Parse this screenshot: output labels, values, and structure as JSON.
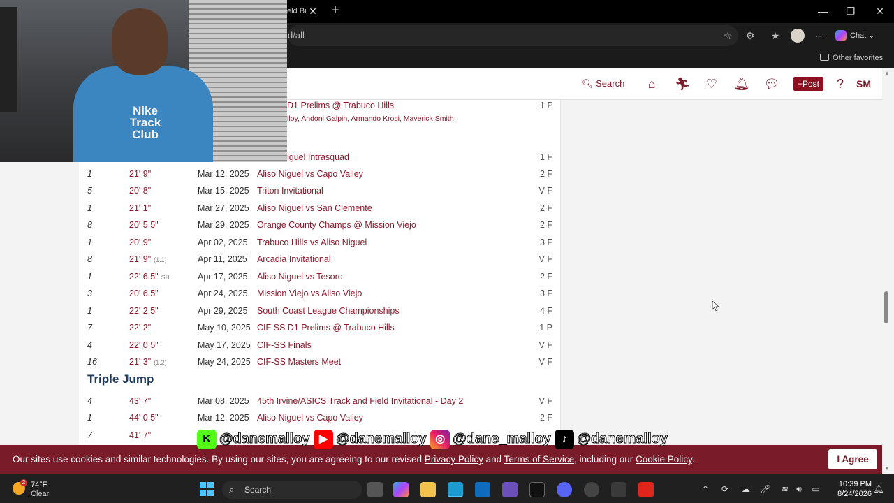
{
  "browser": {
    "tab_title": "eld Bi",
    "url_tail": "d/all",
    "chat_label": "Chat",
    "other_favorites": "Other favorites"
  },
  "webcam": {
    "shirt_text": "Nike Track Club"
  },
  "site": {
    "nav": {
      "search": "Search",
      "post": "+Post",
      "user_initials": "SM"
    },
    "top_partial": {
      "meet": "D1 Prelims @ Trabuco Hills",
      "level": "1 P",
      "athletes": [
        "lloy,",
        "Andoni Galpin,",
        "Armando Krosi,",
        "Maverick Smith"
      ],
      "meet2": "iguel Intrasquad",
      "level2": "1 F"
    },
    "long_jump_rows": [
      {
        "place": "1",
        "mark": "21' 9\"",
        "note": "",
        "date": "Mar 12, 2025",
        "meet": "Aliso Niguel vs Capo Valley",
        "level": "2 F"
      },
      {
        "place": "5",
        "mark": "20' 8\"",
        "note": "",
        "date": "Mar 15, 2025",
        "meet": "Triton Invitational",
        "level": "V F"
      },
      {
        "place": "1",
        "mark": "21' 1\"",
        "note": "",
        "date": "Mar 27, 2025",
        "meet": "Aliso Niguel vs San Clemente",
        "level": "2 F"
      },
      {
        "place": "8",
        "mark": "20' 5.5\"",
        "note": "",
        "date": "Mar 29, 2025",
        "meet": "Orange County Champs @ Mission Viejo",
        "level": "2 F"
      },
      {
        "place": "1",
        "mark": "20' 9\"",
        "note": "",
        "date": "Apr 02, 2025",
        "meet": "Trabuco Hills vs Aliso Niguel",
        "level": "3 F"
      },
      {
        "place": "8",
        "mark": "21' 9\"",
        "note": "(1.1)",
        "date": "Apr 11, 2025",
        "meet": "Arcadia Invitational",
        "level": "V F"
      },
      {
        "place": "1",
        "mark": "22' 6.5\"",
        "note": "SB",
        "date": "Apr 17, 2025",
        "meet": "Aliso Niguel vs Tesoro",
        "level": "2 F"
      },
      {
        "place": "3",
        "mark": "20' 6.5\"",
        "note": "",
        "date": "Apr 24, 2025",
        "meet": "Mission Viejo vs Aliso Viejo",
        "level": "3 F"
      },
      {
        "place": "1",
        "mark": "22' 2.5\"",
        "note": "",
        "date": "Apr 29, 2025",
        "meet": "South Coast League Championships",
        "level": "4 F"
      },
      {
        "place": "7",
        "mark": "22' 2\"",
        "note": "",
        "date": "May 10, 2025",
        "meet": "CIF SS D1 Prelims @ Trabuco Hills",
        "level": "1 P"
      },
      {
        "place": "4",
        "mark": "22' 0.5\"",
        "note": "",
        "date": "May 17, 2025",
        "meet": "CIF-SS Finals",
        "level": "V F"
      },
      {
        "place": "16",
        "mark": "21' 3\"",
        "note": "(1.2)",
        "date": "May 24, 2025",
        "meet": "CIF-SS Masters Meet",
        "level": "V F"
      }
    ],
    "triple_jump_title": "Triple Jump",
    "triple_jump_rows": [
      {
        "place": "4",
        "mark": "43' 7\"",
        "note": "",
        "date": "Mar 08, 2025",
        "meet": "45th Irvine/ASICS Track and Field Invitational - Day 2",
        "level": "V F"
      },
      {
        "place": "1",
        "mark": "44' 0.5\"",
        "note": "",
        "date": "Mar 12, 2025",
        "meet": "Aliso Niguel vs Capo Valley",
        "level": "2 F"
      },
      {
        "place": "7",
        "mark": "41' 7\"",
        "note": "",
        "date": "",
        "meet": "",
        "level": ""
      }
    ]
  },
  "social": {
    "kick": "@danemalloy",
    "youtube": "@danemalloy",
    "instagram": "@dane_malloy",
    "tiktok": "@danemalloy"
  },
  "cookie": {
    "text_1": "Our sites use cookies and similar technologies. By using our sites, you are agreeing to our revised ",
    "privacy_link": "Privacy Policy",
    "and": " and ",
    "terms_link": "Terms of Service",
    "text_2": ", including our ",
    "cookie_link": "Cookie Policy",
    "text_3": ".",
    "agree": "I Agree"
  },
  "taskbar": {
    "weather_badge": "2",
    "temp": "74°F",
    "condition": "Clear",
    "search": "Search",
    "time": "10:39 PM",
    "date": "8/24/2026"
  },
  "colors": {
    "brand": "#7a1b2a",
    "link": "#8b1a2b",
    "section": "#1e3a5f"
  }
}
